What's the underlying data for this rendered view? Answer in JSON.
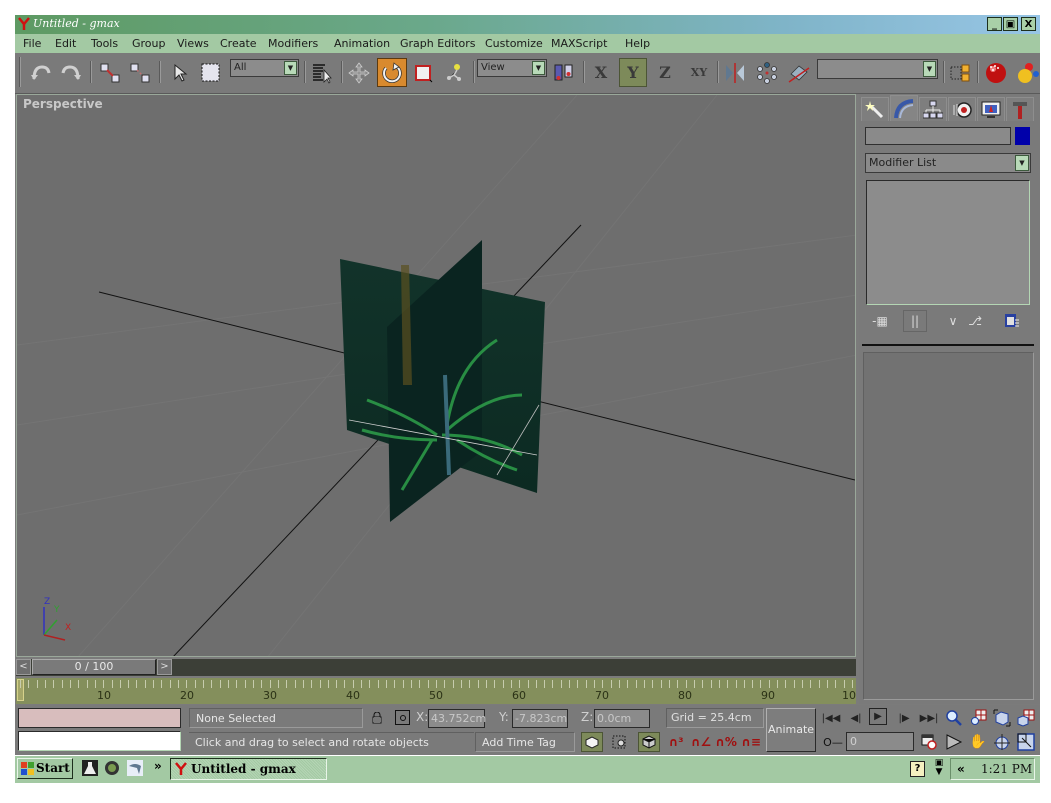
{
  "window": {
    "title": "Untitled - gmax",
    "minimize": "_",
    "restore": "🗗",
    "close": "X"
  },
  "menu": [
    "File",
    "Edit",
    "Tools",
    "Group",
    "Views",
    "Create",
    "Modifiers",
    "Animation",
    "Graph Editors",
    "Customize",
    "MAXScript",
    "Help"
  ],
  "toolbar": {
    "selection_filter": "All",
    "ref_coord_system": "View",
    "named_selection": "",
    "axis_x": "X",
    "axis_y": "Y",
    "axis_z": "Z",
    "axis_xy": "XY",
    "active_tool": "select-and-rotate",
    "active_axis": "Y"
  },
  "viewport": {
    "label": "Perspective",
    "gizmo": {
      "z": "Z",
      "y": "Y",
      "x": "X"
    }
  },
  "command_panel": {
    "tabs": [
      "create",
      "modify",
      "hierarchy",
      "motion",
      "display",
      "utilities"
    ],
    "active_tab": "modify",
    "object_name": "",
    "object_color": "#0000aa",
    "modifier_list": "Modifier List"
  },
  "time_slider": {
    "label": "0 / 100",
    "current_frame": 0,
    "total_frames": 100,
    "prev": "<",
    "next": ">"
  },
  "trackbar": {
    "ticks": [
      "10",
      "20",
      "30",
      "40",
      "50",
      "60",
      "70",
      "80",
      "90",
      "10"
    ]
  },
  "status": {
    "selection": "None Selected",
    "prompt": "Click and drag to select and rotate objects",
    "x_label": "X:",
    "x_value": "43.752cm",
    "y_label": "Y:",
    "y_value": "-7.823cm",
    "z_label": "Z:",
    "z_value": "0.0cm",
    "grid": "Grid = 25.4cm",
    "add_time_tag": "Add Time Tag",
    "animate": "Animate",
    "frame_value": "0"
  },
  "taskbar": {
    "start": "Start",
    "chevron": "»",
    "task": "Untitled - gmax",
    "tray_chevron": "«",
    "clock": "1:21 PM"
  },
  "colors": {
    "title_gradient_start": "#5e9a63",
    "title_gradient_end": "#97c5e5",
    "menu_bg": "#a3c9a3",
    "active_tool": "#d98a2e",
    "viewport_bg": "#6e6e6e",
    "trackbar_bg": "#848f5c"
  }
}
